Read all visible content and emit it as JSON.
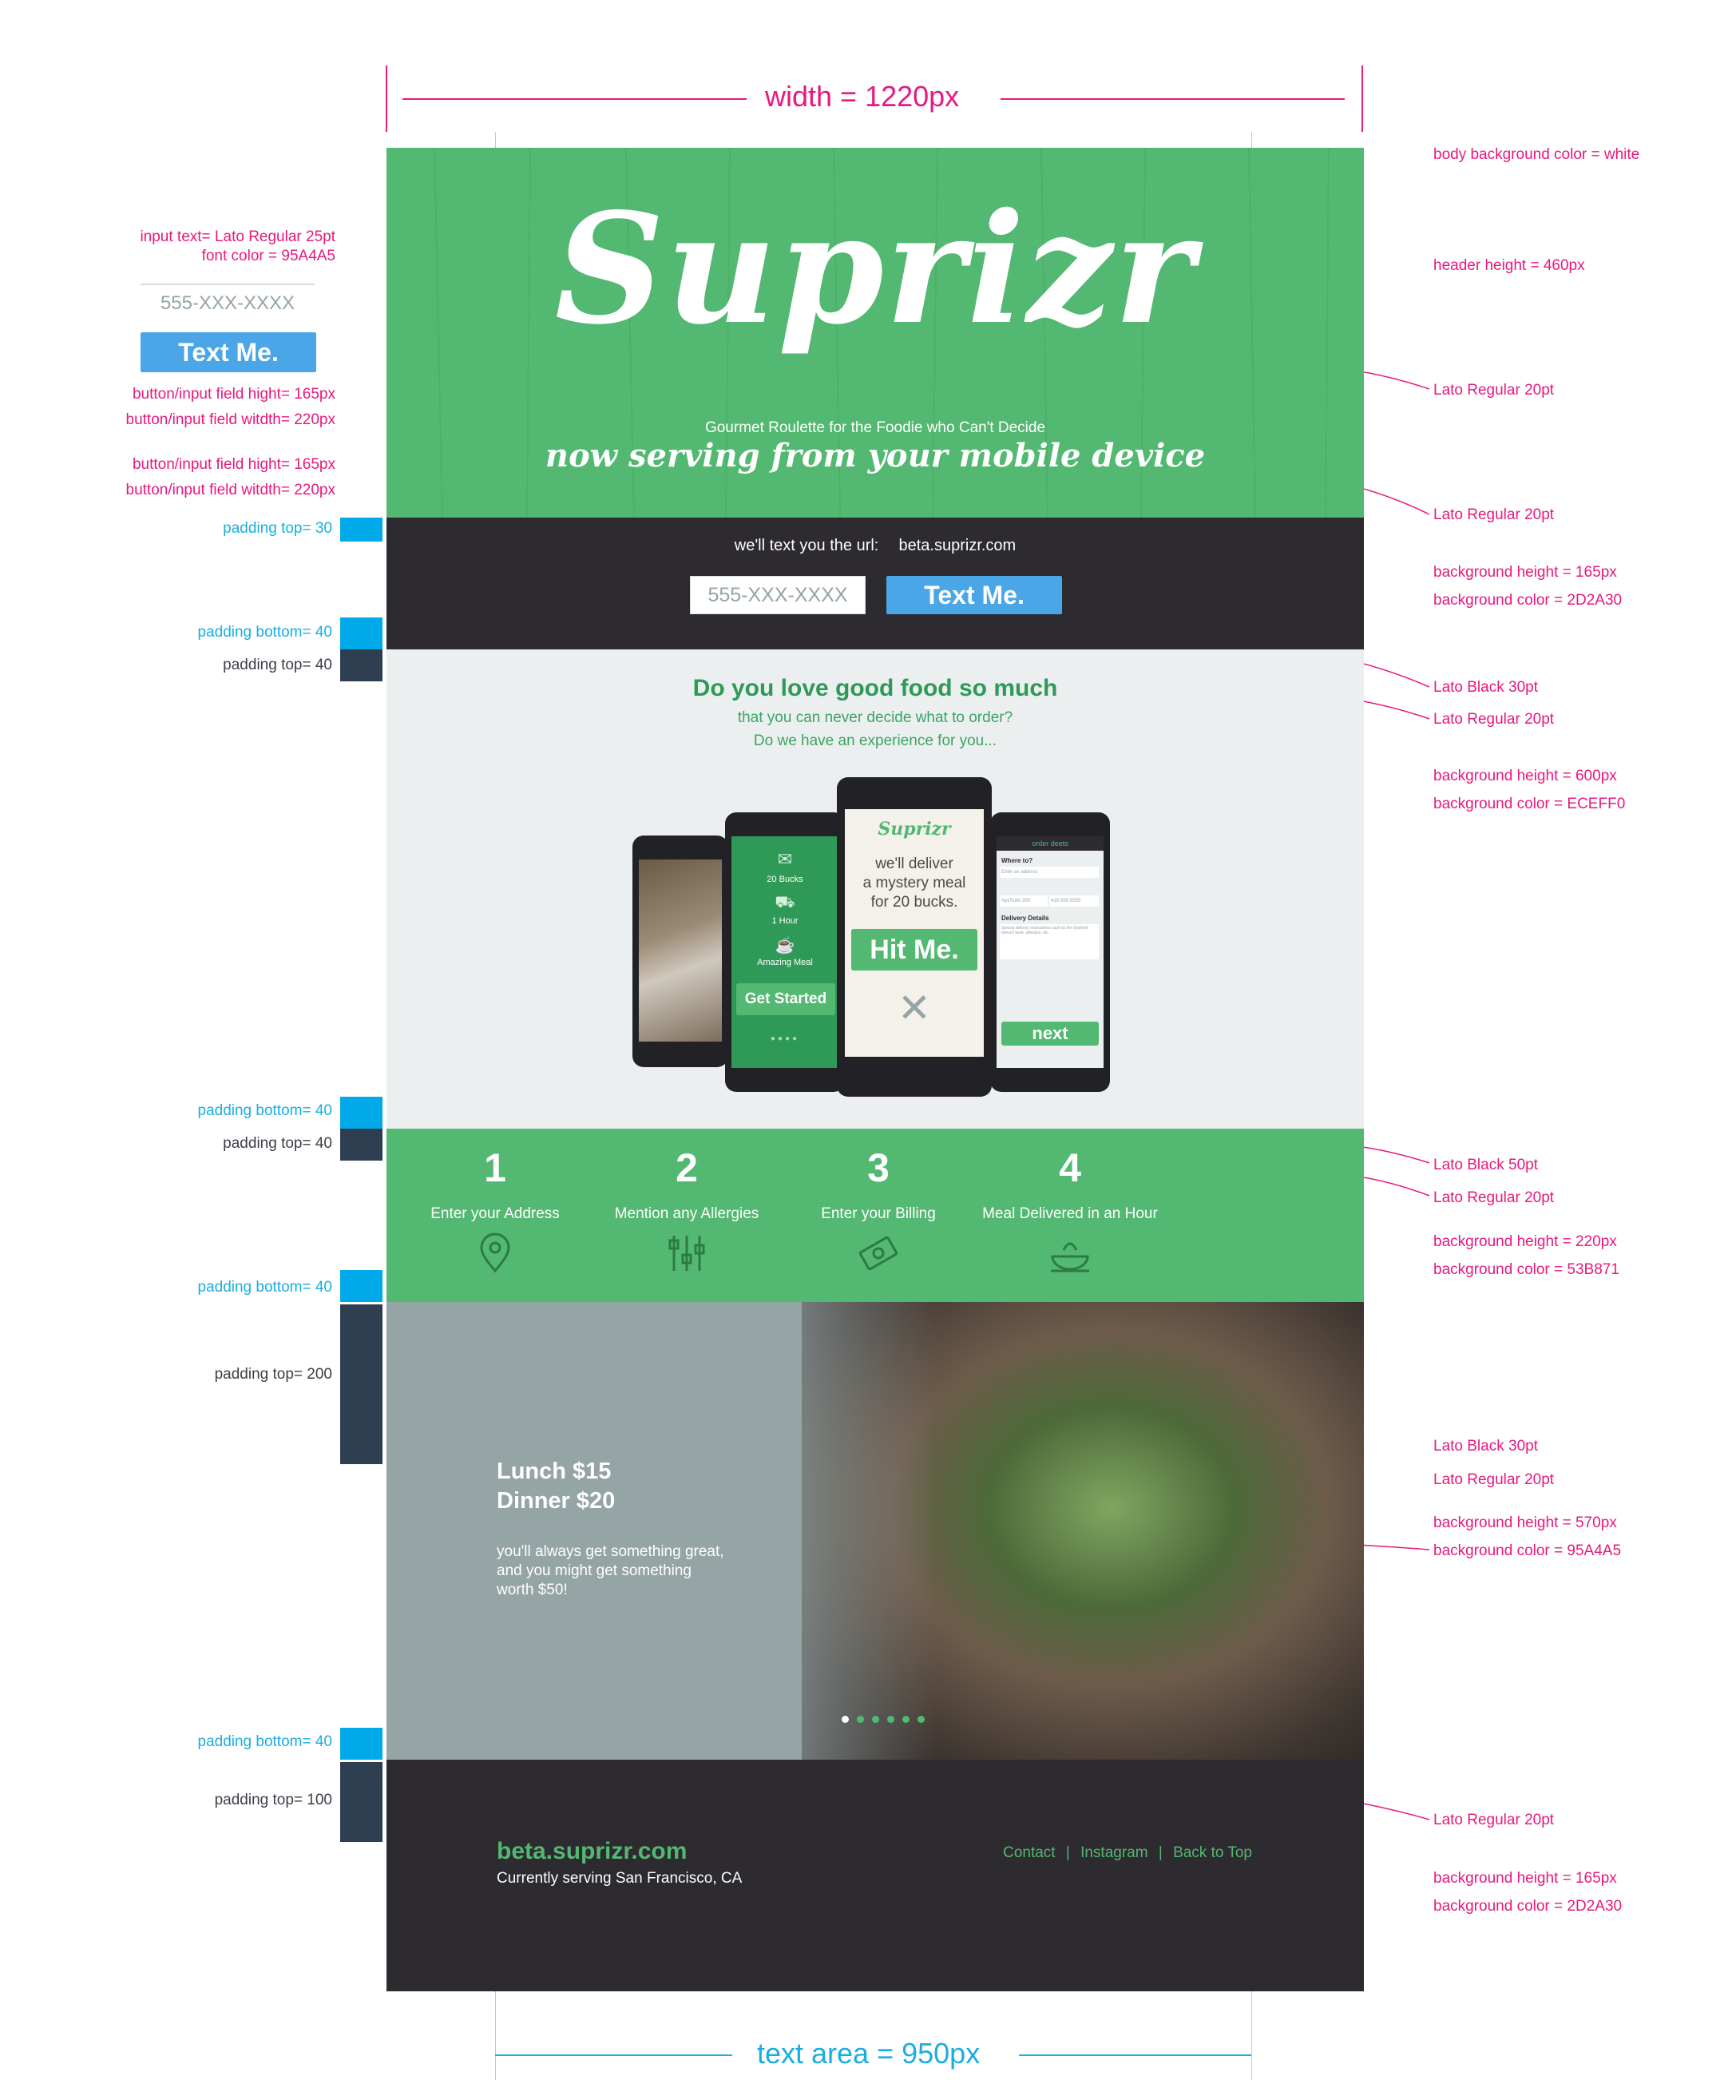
{
  "annotations": {
    "width_label": "width = 1220px",
    "text_area_label": "text area = 950px",
    "left": {
      "input_text": "input text= Lato Regular 25pt",
      "font_color": "font color = 95A4A5",
      "sample_placeholder": "555-XXX-XXXX",
      "sample_button": "Text Me.",
      "btn_height_1": "button/input field hight= 165px",
      "btn_width_1": "button/input field witdth= 220px",
      "btn_height_2": "button/input field hight= 165px",
      "btn_width_2": "button/input field witdth= 220px",
      "padding_top_30": "padding top= 30",
      "padding_bottom_40_a": "padding bottom= 40",
      "padding_top_40_a": "padding top= 40",
      "padding_bottom_40_b": "padding bottom= 40",
      "padding_top_40_b": "padding top= 40",
      "padding_bottom_40_c": "padding bottom= 40",
      "padding_top_200": "padding top= 200",
      "padding_bottom_40_d": "padding bottom= 40",
      "padding_top_100": "padding top= 100"
    },
    "right": {
      "body_bg": "body background color = white",
      "header_height": "header height = 460px",
      "lato20_a": "Lato Regular 20pt",
      "lato20_b": "Lato Regular 20pt",
      "bg_h_165_a": "background height = 165px",
      "bg_c_2d2a30_a": "background color = 2D2A30",
      "lato_black_30_a": "Lato Black 30pt",
      "lato20_c": "Lato Regular 20pt",
      "bg_h_600": "background height = 600px",
      "bg_c_eceff0": "background color = ECEFF0",
      "lato_black_50": "Lato Black 50pt",
      "lato20_d": "Lato Regular 20pt",
      "bg_h_220": "background height = 220px",
      "bg_c_53b871": "background color = 53B871",
      "lato_black_30_b": "Lato Black 30pt",
      "lato20_e": "Lato Regular 20pt",
      "bg_h_570": "background height = 570px",
      "bg_c_95a4a5": "background color = 95A4A5",
      "lato20_f": "Lato Regular 20pt",
      "bg_h_165_b": "background height = 165px",
      "bg_c_2d2a30_b": "background color = 2D2A30"
    }
  },
  "header": {
    "logo": "Suprizr",
    "tagline": "Gourmet Roulette for the Foodie who Can't Decide",
    "subtitle": "now serving from your mobile device"
  },
  "url_bar": {
    "prompt": "we'll text you the url:",
    "url": "beta.suprizr.com",
    "phone_placeholder": "555-XXX-XXXX",
    "button": "Text Me."
  },
  "intro": {
    "headline": "Do you love good food so much",
    "line2": "that you can never decide what to order?",
    "line3": "Do we have an experience for you..."
  },
  "phones": {
    "p2": {
      "item1": "20 Bucks",
      "item2": "1 Hour",
      "item3": "Amazing Meal",
      "button": "Get Started"
    },
    "p3": {
      "logo": "Suprizr",
      "text1": "we'll deliver",
      "text2": "a mystery meal",
      "text3": "for 20 bucks.",
      "button": "Hit Me."
    },
    "p4": {
      "title": "order deets",
      "where": "Where to?",
      "addr": "Enter an address",
      "apt": "Apt/Suite 300",
      "phone": "415-555-5555",
      "details": "Delivery Details",
      "details_hint": "Special delivery instructions such as the doorbell doesn't work, allergies, etc.",
      "button": "next"
    }
  },
  "steps": [
    {
      "num": "1",
      "label": "Enter your Address",
      "icon": "map-pin-icon"
    },
    {
      "num": "2",
      "label": "Mention any Allergies",
      "icon": "sliders-icon"
    },
    {
      "num": "3",
      "label": "Enter your Billing",
      "icon": "money-icon"
    },
    {
      "num": "4",
      "label": "Meal Delivered in an Hour",
      "icon": "food-bowl-icon"
    }
  ],
  "promo": {
    "lunch": "Lunch $15",
    "dinner": "Dinner $20",
    "line1": "you'll always get something great,",
    "line2": "and you might get something",
    "line3": "worth $50!"
  },
  "footer": {
    "url": "beta.suprizr.com",
    "serving": "Currently serving San Francisco, CA",
    "links": [
      "Contact",
      "Instagram",
      "Back to Top"
    ],
    "sep": "|"
  },
  "colors": {
    "green": "#53b871",
    "dark": "#2d2a30",
    "light": "#eceff0",
    "gray": "#95a4a5",
    "blue_button": "#4aa6e6",
    "annotation_pink": "#e8187e",
    "annotation_cyan": "#1aaee0"
  }
}
